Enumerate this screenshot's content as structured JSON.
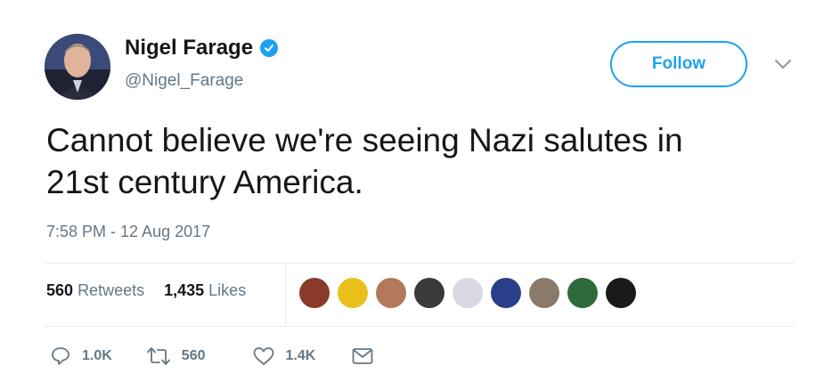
{
  "user": {
    "display_name": "Nigel Farage",
    "handle": "@Nigel_Farage",
    "verified": true
  },
  "follow_button": {
    "label": "Follow"
  },
  "tweet": {
    "text_line1": "Cannot believe we're seeing Nazi salutes in",
    "text_line2": "21st century America.",
    "timestamp": "7:58 PM - 12 Aug 2017"
  },
  "stats": {
    "retweets_count": "560",
    "retweets_label": "Retweets",
    "likes_count": "1,435",
    "likes_label": "Likes"
  },
  "likers": [
    {
      "name": "liker-avatar-1",
      "color": "#8a3a2a"
    },
    {
      "name": "liker-avatar-2",
      "color": "#e9c11a"
    },
    {
      "name": "liker-avatar-3",
      "color": "#b27a5a"
    },
    {
      "name": "liker-avatar-4",
      "color": "#3a3a3a"
    },
    {
      "name": "liker-avatar-5",
      "color": "#d9d9e6"
    },
    {
      "name": "liker-avatar-6",
      "color": "#2a3f8a"
    },
    {
      "name": "liker-avatar-7",
      "color": "#8a7a6a"
    },
    {
      "name": "liker-avatar-8",
      "color": "#2f6b3a"
    },
    {
      "name": "liker-avatar-9",
      "color": "#1a1a1a"
    }
  ],
  "actions": {
    "reply_count": "1.0K",
    "retweet_count": "560",
    "like_count": "1.4K"
  },
  "colors": {
    "accent": "#1da1f2",
    "text": "#14171a",
    "muted": "#657786",
    "divider": "#e6ecf0"
  }
}
